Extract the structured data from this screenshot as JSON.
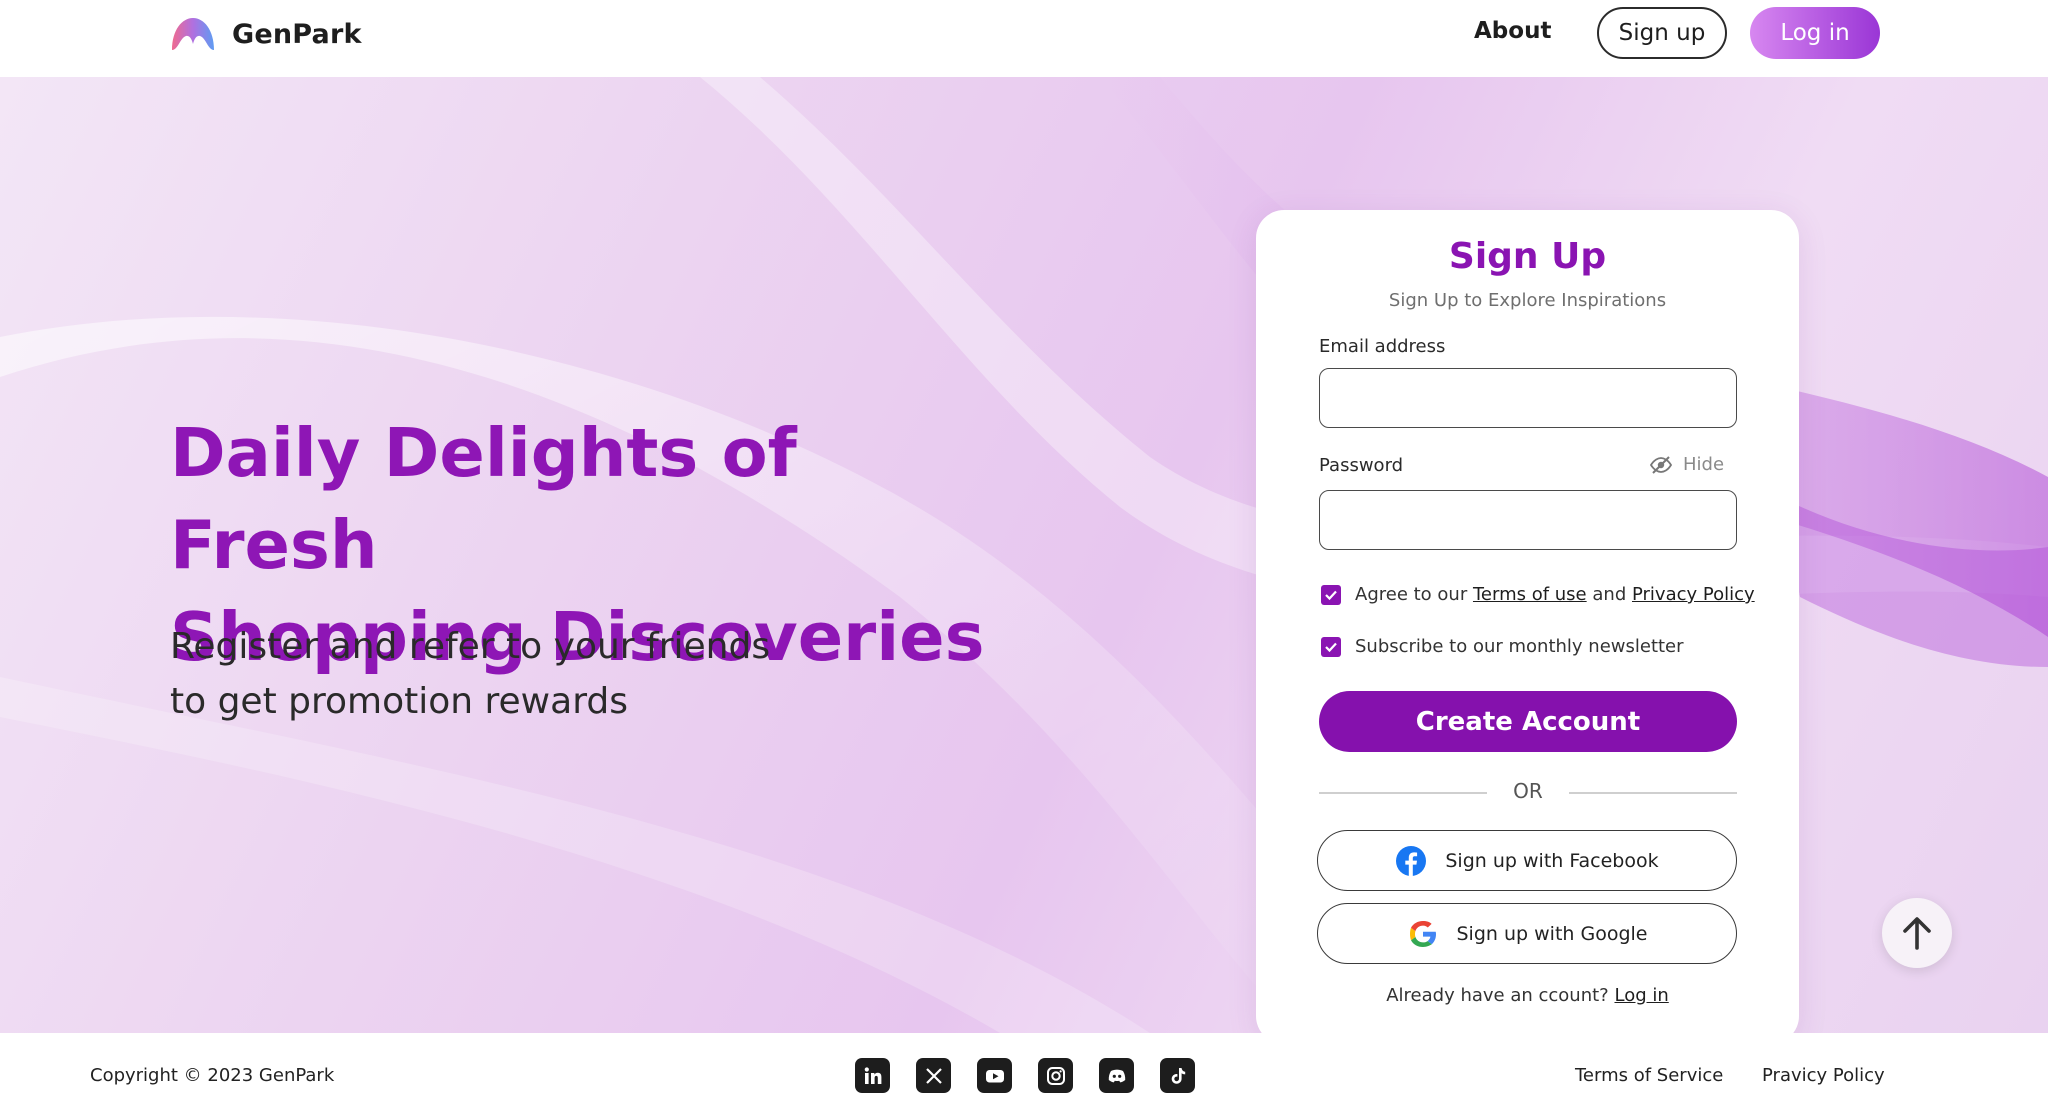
{
  "header": {
    "brand": "GenPark",
    "nav": {
      "about": "About",
      "signup": "Sign up",
      "login": "Log in"
    }
  },
  "hero": {
    "title_line1": "Daily Delights of Fresh",
    "title_line2": "Shopping Discoveries",
    "subtitle_line1": "Register and refer to your friends",
    "subtitle_line2": "to get promotion rewards"
  },
  "signup_form": {
    "title": "Sign Up",
    "subtitle": "Sign Up to Explore Inspirations",
    "email_label": "Email address",
    "email_value": "",
    "password_label": "Password",
    "password_value": "",
    "hide_label": "Hide",
    "terms_prefix": "Agree to our",
    "terms_link": "Terms of use",
    "terms_and": "and",
    "privacy_link": "Privacy Policy",
    "terms_checked": true,
    "newsletter_label": "Subscribe to our monthly newsletter",
    "newsletter_checked": true,
    "create_button": "Create Account",
    "or_text": "OR",
    "facebook_button": "Sign up with Facebook",
    "google_button": "Sign up with Google",
    "already_text": "Already have an ccount?",
    "login_link": "Log in"
  },
  "footer": {
    "copyright": "Copyright © 2023 GenPark",
    "social": [
      "linkedin-icon",
      "x-icon",
      "youtube-icon",
      "instagram-icon",
      "discord-icon",
      "tiktok-icon"
    ],
    "terms": "Terms of Service",
    "privacy": "Pravicy Policy"
  },
  "colors": {
    "accent": "#8511ad",
    "title_purple": "#8e16b5",
    "login_gradient_start": "#d787f0",
    "login_gradient_end": "#9a36d6"
  }
}
